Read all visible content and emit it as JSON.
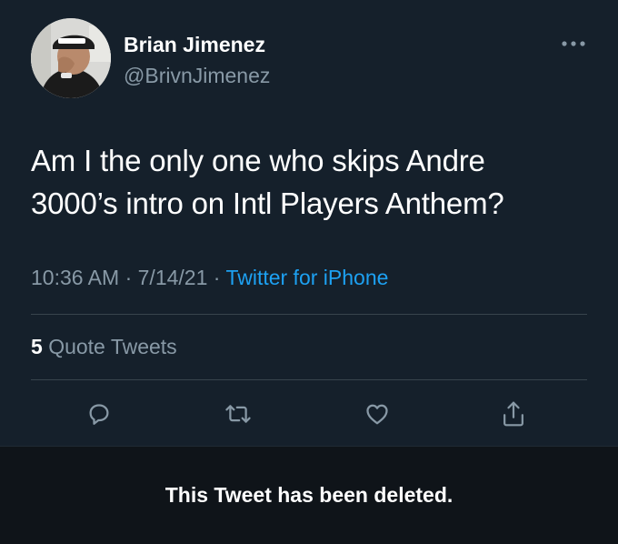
{
  "tweet": {
    "author": {
      "display_name": "Brian Jimenez",
      "handle": "@BrivnJimenez",
      "avatar_icon": "user-avatar"
    },
    "text_line1": "Am I the only one who skips Andre",
    "text_line2": "3000’s intro on Intl Players Anthem?",
    "time": "10:36 AM",
    "separator": "·",
    "date": "7/14/21",
    "source": "Twitter for iPhone",
    "quote_count": "5",
    "quote_label": "Quote Tweets",
    "actions": [
      "reply-icon",
      "retweet-icon",
      "like-icon",
      "share-icon"
    ]
  },
  "deleted_notice": "This Tweet has been deleted.",
  "colors": {
    "background": "#15202b",
    "banner": "#0f1419",
    "secondary_text": "#8899a6",
    "link": "#1da1f2",
    "divider": "#38444d"
  }
}
